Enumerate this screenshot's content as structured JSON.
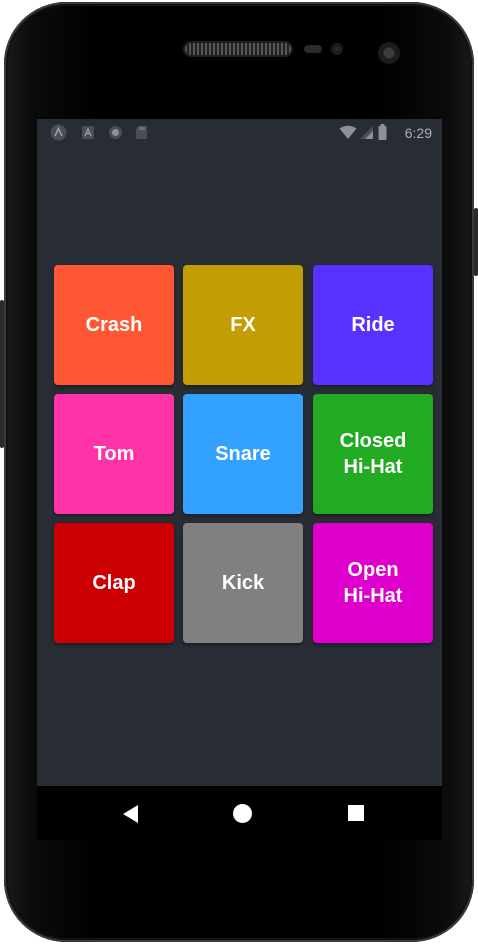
{
  "statusbar": {
    "time": "6:29",
    "left_icons": [
      "app-a-icon",
      "a-badge-icon",
      "circle-icon",
      "sd-card-icon"
    ],
    "right_icons": [
      "wifi-icon",
      "signal-icon",
      "battery-icon"
    ]
  },
  "pads": [
    {
      "label": "Crash",
      "color": "#ff5733"
    },
    {
      "label": "FX",
      "color": "#c29d03"
    },
    {
      "label": "Ride",
      "color": "#5833ff"
    },
    {
      "label": "Tom",
      "color": "#ff33a6"
    },
    {
      "label": "Snare",
      "color": "#33a1ff"
    },
    {
      "label": "Closed\nHi-Hat",
      "color": "#22aa22"
    },
    {
      "label": "Clap",
      "color": "#cc0000"
    },
    {
      "label": "Kick",
      "color": "#808080"
    },
    {
      "label": "Open\nHi-Hat",
      "color": "#dd00cc"
    }
  ],
  "navbar": {
    "icons": [
      "back-icon",
      "home-icon",
      "recents-icon"
    ]
  },
  "colors": {
    "screen_bg": "#282c34",
    "navbar_bg": "#000000"
  }
}
